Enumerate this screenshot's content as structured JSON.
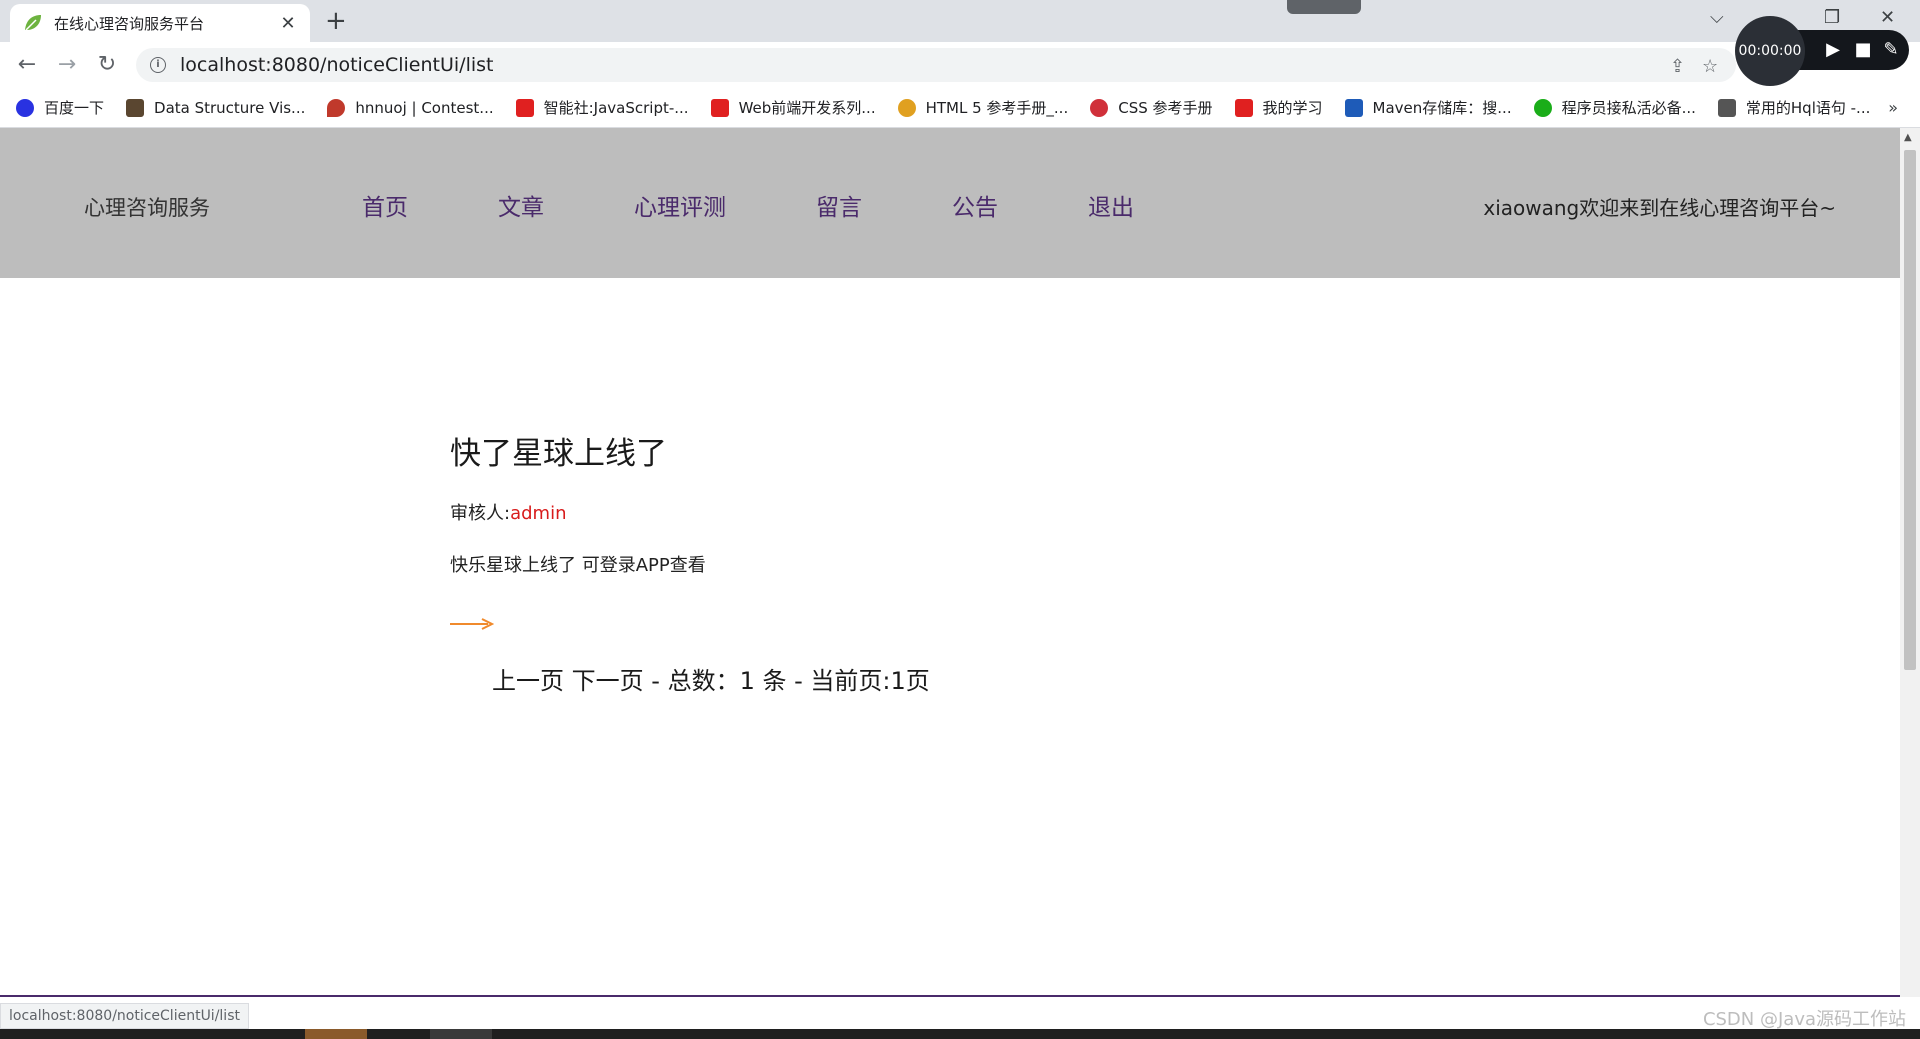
{
  "browser": {
    "tab": {
      "title": "在线心理咨询服务平台",
      "close": "✕"
    },
    "new_tab": "+",
    "window_controls": {
      "dropdown": "⌵",
      "restore": "❐",
      "close": "✕"
    },
    "nav": {
      "back": "←",
      "forward": "→",
      "reload": "↻"
    },
    "address": {
      "info": "i",
      "url": "localhost:8080/noticeClientUi/list"
    },
    "omnibox_icons": {
      "share": "⇪",
      "star": "☆"
    },
    "recorder": {
      "time": "00:00:00",
      "play": "▶",
      "stop": "■",
      "pen": "✎"
    },
    "bookmarks": [
      {
        "label": "百度一下",
        "icon": "paw-icon",
        "color": "#2932e1"
      },
      {
        "label": "Data Structure Vis...",
        "icon": "dsv-icon",
        "color": "#5a4630"
      },
      {
        "label": "hnnuoj | Contest...",
        "icon": "pin-icon",
        "color": "#c0392b"
      },
      {
        "label": "智能社:JavaScript-...",
        "icon": "book-icon",
        "color": "#e02020"
      },
      {
        "label": "Web前端开发系列...",
        "icon": "book-icon",
        "color": "#e02020"
      },
      {
        "label": "HTML 5 参考手册_...",
        "icon": "html5-icon",
        "color": "#e0a020"
      },
      {
        "label": "CSS 参考手册",
        "icon": "css-icon",
        "color": "#d0303a"
      },
      {
        "label": "我的学习",
        "icon": "book-icon",
        "color": "#e02020"
      },
      {
        "label": "Maven存储库：搜...",
        "icon": "maven-icon",
        "color": "#1e5bb8"
      },
      {
        "label": "程序员接私活必备...",
        "icon": "wechat-icon",
        "color": "#1aad19"
      },
      {
        "label": "常用的Hql语句 -...",
        "icon": "hql-icon",
        "color": "#555555"
      }
    ],
    "bookmarks_more": "»",
    "status_tip": "localhost:8080/noticeClientUi/list"
  },
  "site": {
    "logo": "心理咨询服务",
    "nav": [
      "首页",
      "文章",
      "心理评测",
      "留言",
      "公告",
      "退出"
    ],
    "welcome": "xiaowang欢迎来到在线心理咨询平台~",
    "accent_color": "#4a2a6b"
  },
  "notice": {
    "title": "快了星球上线了",
    "reviewer_label": "审核人:",
    "reviewer": "admin",
    "content": "快乐星球上线了 可登录APP查看",
    "arrow_color": "#f08a2c"
  },
  "pager": {
    "prev": "上一页",
    "next": "下一页",
    "summary": "- 总数：1 条 - 当前页:1页"
  },
  "watermark": "CSDN @Java源码工作站"
}
